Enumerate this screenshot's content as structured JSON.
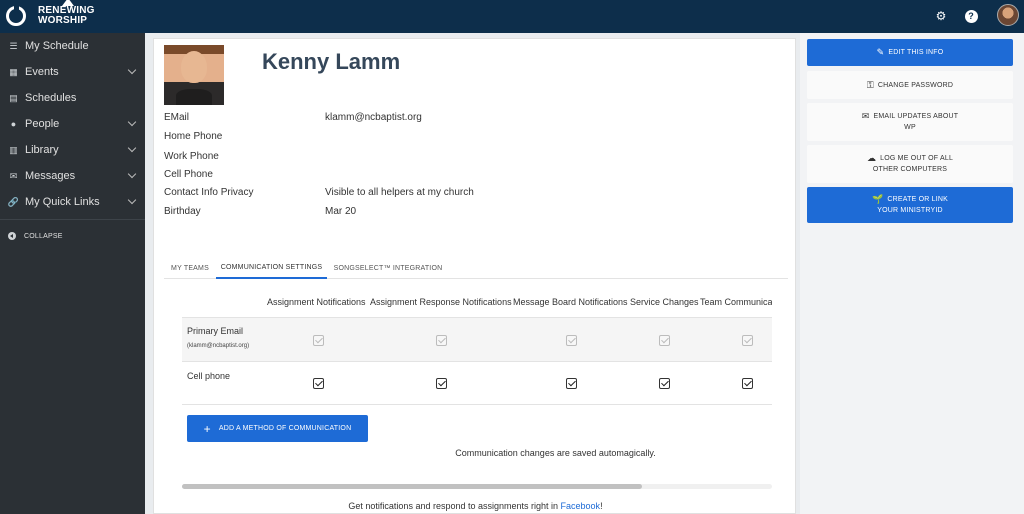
{
  "header": {
    "brand_line1": "RENEWING",
    "brand_line2": "WORSHIP",
    "settings_icon": "gear-icon",
    "help_icon": "help-icon",
    "help_glyph": "?",
    "avatar": "user-avatar"
  },
  "sidebar": {
    "items": [
      {
        "label": "My Schedule",
        "icon": "list-icon"
      },
      {
        "label": "Events",
        "icon": "calendar-icon"
      },
      {
        "label": "Schedules",
        "icon": "document-icon"
      },
      {
        "label": "People",
        "icon": "people-icon"
      },
      {
        "label": "Library",
        "icon": "library-icon"
      },
      {
        "label": "Messages",
        "icon": "envelope-icon"
      },
      {
        "label": "My Quick Links",
        "icon": "link-icon"
      }
    ],
    "collapse_label": "COLLAPSE"
  },
  "profile": {
    "name": "Kenny Lamm",
    "fields": [
      {
        "label": "EMail",
        "value": "klamm@ncbaptist.org"
      },
      {
        "label": "Home Phone",
        "value": ""
      },
      {
        "label": "Work Phone",
        "value": ""
      },
      {
        "label": "Cell Phone",
        "value": ""
      },
      {
        "label": "Contact Info Privacy",
        "value": "Visible to all helpers at my church"
      },
      {
        "label": "Birthday",
        "value": "Mar 20"
      }
    ]
  },
  "tabs": [
    {
      "label": "MY TEAMS",
      "active": false
    },
    {
      "label": "COMMUNICATION SETTINGS",
      "active": true
    },
    {
      "label": "SONGSELECT™ INTEGRATION",
      "active": false
    }
  ],
  "communication": {
    "columns": [
      "Assignment Notifications",
      "Assignment Response Notifications",
      "Message Board Notifications",
      "Service Changes",
      "Team Communications"
    ],
    "rows": [
      {
        "label": "Primary Email",
        "sub": "(klamm@ncbaptist.org)",
        "checked": [
          true,
          true,
          true,
          true,
          true
        ],
        "enabled": false
      },
      {
        "label": "Cell phone",
        "sub": "",
        "checked": [
          true,
          true,
          true,
          true,
          true
        ],
        "enabled": true
      }
    ],
    "add_button": "ADD A METHOD OF COMMUNICATION",
    "saved_note": "Communication changes are saved automagically.",
    "footer_text": "Get notifications and respond to assignments right in ",
    "footer_link": "Facebook",
    "footer_end": "!"
  },
  "right_panel": {
    "edit_info": "EDIT THIS INFO",
    "change_password": "CHANGE PASSWORD",
    "email_updates_1": "EMAIL UPDATES ABOUT",
    "email_updates_2": "WP",
    "logout_1": "LOG ME OUT OF ALL",
    "logout_2": "OTHER COMPUTERS",
    "ministry_1": "CREATE OR LINK",
    "ministry_2": "YOUR MINISTRYID"
  },
  "colors": {
    "topbar": "#0d2e4b",
    "sidebar": "#2b3035",
    "accent": "#1e6bd6"
  }
}
